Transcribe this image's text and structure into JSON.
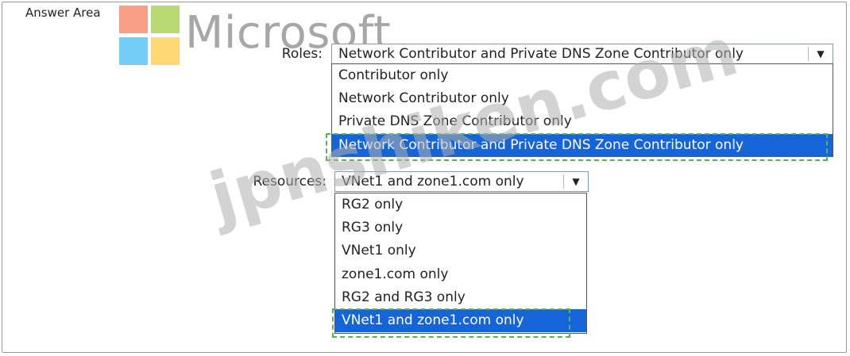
{
  "answer_area": {
    "label": "Answer Area"
  },
  "logo": {
    "wordmark": "Microsoft"
  },
  "watermark": {
    "text": "jpnshiken.com"
  },
  "roles": {
    "label": "Roles:",
    "selected": "Network Contributor and Private DNS Zone Contributor only",
    "options": [
      "Contributor only",
      "Network Contributor only",
      "Private DNS Zone Contributor only",
      "Network Contributor and Private DNS Zone Contributor only"
    ],
    "highlighted_index": 3
  },
  "resources": {
    "label": "Resources:",
    "selected": "VNet1 and zone1.com only",
    "options": [
      "RG2 only",
      "RG3 only",
      "VNet1 only",
      "zone1.com only",
      "RG2 and RG3 only",
      "VNet1 and zone1.com only"
    ],
    "highlighted_index": 5
  },
  "colors": {
    "highlight": "#1565d8",
    "answer_outline": "#58b058",
    "logo_red": "#f25022",
    "logo_green": "#7fba00",
    "logo_blue": "#00a4ef",
    "logo_yellow": "#ffb900"
  },
  "icons": {
    "dropdown": "chevron-down-icon"
  }
}
